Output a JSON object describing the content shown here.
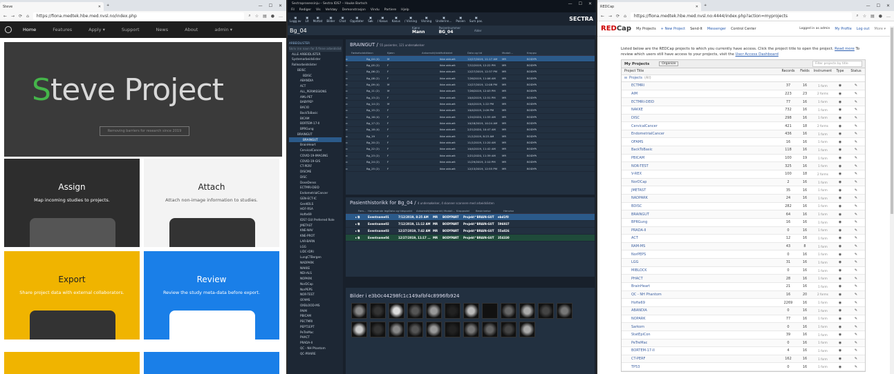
{
  "steve": {
    "tab": "Steve",
    "url": "https://fiona.medtek.hbe.med.nvsl.no/index.php",
    "nav": [
      "Home",
      "Features",
      "Apply ▾",
      "Support",
      "News",
      "About",
      "admin ▾"
    ],
    "hero_title_s": "S",
    "hero_title_rest": "teve Project",
    "hero_subtitle": "Removing barriers for research since 2019",
    "cards": [
      {
        "title": "Assign",
        "desc": "Map incoming studies to projects."
      },
      {
        "title": "Attach",
        "desc": "Attach non-image information to studies."
      },
      {
        "title": "Export",
        "desc": "Share project data with external collaborators."
      },
      {
        "title": "Review",
        "desc": "Review the study meta-data before export."
      }
    ]
  },
  "sectra": {
    "tab": "Sectraprosessinju – Sectra IDS7 – Hauke Bartsch",
    "menu": [
      "Fil",
      "Rediger",
      "Vis",
      "Verktøy",
      "Demonstrasjon",
      "Vindu",
      "Partiere",
      "Hjelp"
    ],
    "toolbar": [
      "Logg av",
      "Lit",
      "Mottat",
      "Bilder",
      "Chat",
      "Oppdater",
      "Søk",
      "/ Kasus",
      "Kasus",
      "/ Visning",
      "Visning",
      "Underinn...",
      "Pasien",
      "Sum pas."
    ],
    "brand": "SECTRA",
    "patient_id": "Bg_04",
    "sex_label": "Kjønn",
    "sex": "Mann",
    "pid_label": "Pasientnummer",
    "pid": "BG_04",
    "age_label": "Alder",
    "tree_head": "ARBEIDLISTER",
    "tree_search": "Skriv inn navn for å finne arbeidslister",
    "tree": [
      "ALLE ARBEIDLISTER",
      "Systemarbeidslister",
      "Rollearbeidslister",
      "BEISC",
      "BDISC",
      "ABANDIA",
      "ACT",
      "ALL_PERMISSIONS",
      "AML-PET",
      "BABYPEP",
      "BACIO",
      "BackToBasic",
      "BICAM",
      "BORTEM-17-II",
      "BPRGung",
      "BRAINGUT",
      "BRAINGUT",
      "BrainHeart",
      "CervicalCancer",
      "COVID-19-IMAGING",
      "COVID-19-GIS",
      "CT-PERF",
      "DISCME",
      "DISC",
      "DoseDenss",
      "ECTMRI-DEID",
      "EndometrialCancer",
      "GEN-ECT-IC",
      "GenKOLS",
      "HOF-RSA",
      "Hofte69",
      "IDS7 GUI Preferred Role",
      "JMETAST",
      "KNE-NAV",
      "KNE-PROT",
      "LAR-BARN",
      "LGG",
      "LIDC-IDRI",
      "LungCTBergen",
      "NADPARK",
      "NAKKE",
      "NDI-ALS",
      "NOPARK",
      "NorDCap",
      "NorPEPS",
      "NOR-TEST",
      "OFAMS",
      "OXBLOOD-MS",
      "PAIM",
      "PBICAM",
      "PECTMRI",
      "PEPT1EPT",
      "PeTreMac",
      "PHACT",
      "PRADA-II",
      "QC - NH Phantom",
      "QC-PRAIRE"
    ],
    "worklist_title": "BRAINGUT",
    "worklist_sub": "55 pasienter, 121 undersøkelser",
    "cols": [
      "Fødselsdato",
      "Navn",
      "Kjønn",
      "Ankomstt(tidspunkt)",
      "Mottbidet",
      "Dato og tid",
      "Modali...",
      "Kroppsdel"
    ],
    "rows": [
      [
        "",
        "Bg_04 (4)",
        "M",
        "",
        "Ikke aktuelt",
        "12/27/2019, 11:17 AM",
        "MR",
        "BODYPART"
      ],
      [
        "",
        "Bg_05 (2)",
        "F",
        "",
        "Ikke aktuelt",
        "7/12/2019, 12:22 PM",
        "MR",
        "BODYPART"
      ],
      [
        "",
        "Bg_06 (2)",
        "F",
        "",
        "Ikke aktuelt",
        "12/27/2019, 12:37 PM",
        "MR",
        "BODYPART"
      ],
      [
        "",
        "Bg_08 (2)",
        "F",
        "",
        "Ikke aktuelt",
        "7/26/2019, 11:06 AM",
        "MR",
        "BODYPART"
      ],
      [
        "",
        "Bg_09 (4)",
        "M",
        "",
        "Ikke aktuelt",
        "12/27/2019, 12:08 PM",
        "MR",
        "BODYPART"
      ],
      [
        "",
        "Bg_11 (2)",
        "M",
        "",
        "Ikke aktuelt",
        "7/26/2019, 12:03 PM",
        "MR",
        "BODYPART"
      ],
      [
        "",
        "Bg_13 (2)",
        "F",
        "",
        "Ikke aktuelt",
        "10/4/2019, 12:51 PM",
        "MR",
        "BODYPART"
      ],
      [
        "",
        "Bg_14 (2)",
        "M",
        "",
        "Ikke aktuelt",
        "10/4/2019, 1:22 PM",
        "MR",
        "BODYPART"
      ],
      [
        "",
        "Bg_15 (2)",
        "F",
        "",
        "Ikke aktuelt",
        "10/4/2019, 2:09 PM",
        "MR",
        "BODYPART"
      ],
      [
        "",
        "Bg_16 (4)",
        "F",
        "",
        "Ikke aktuelt",
        "1/24/2020, 11:55 AM",
        "MR",
        "BODYPART"
      ],
      [
        "",
        "Bg_17 (2)",
        "F",
        "",
        "Ikke aktuelt",
        "10/18/2019, 10:24 AM",
        "MR",
        "BODYPART"
      ],
      [
        "",
        "Bg_18 (4)",
        "F",
        "",
        "Ikke aktuelt",
        "2/21/2020, 10:47 AM",
        "MR",
        "BODYPART"
      ],
      [
        "",
        "Bg_19",
        "F",
        "",
        "Ikke aktuelt",
        "11/1/2019, 8:23 AM",
        "MR",
        "BODYPART"
      ],
      [
        "",
        "Bg_20 (2)",
        "F",
        "",
        "Ikke aktuelt",
        "11/1/2019, 11:20 AM",
        "MR",
        "BODYPART"
      ],
      [
        "",
        "Bg_22 (2)",
        "F",
        "",
        "Ikke aktuelt",
        "10/4/2019, 11:42 AM",
        "MR",
        "BODYPART"
      ],
      [
        "",
        "Bg_23 (2)",
        "F",
        "",
        "Ikke aktuelt",
        "2/21/2020, 11:39 AM",
        "MR",
        "BODYPART"
      ],
      [
        "",
        "Bg_24 (2)",
        "F",
        "",
        "Ikke aktuelt",
        "11/29/2019, 2:10 PM",
        "MR",
        "BODYPART"
      ],
      [
        "",
        "Bg_25 (2)",
        "F",
        "",
        "Ikke aktuelt",
        "12/13/2019, 12:55 PM",
        "MR",
        "BODYPART"
      ]
    ],
    "history_title": "Pasienthistorikk for Bg_04",
    "history_sub": "4 undersøkelser, 4 skanner scannere med arbeidslisten",
    "hcols": [
      "Fem...",
      "Henvisende lege",
      "Dato og tidspunkt",
      "Ankomstt(tidspunkt)",
      "Modali...",
      "Kroppsdel",
      "Beskrivelse",
      "Henvisn"
    ],
    "hrows": [
      [
        "Eventname01",
        "7/12/2019, 8:25 AM",
        "MR",
        "BODYPART",
        "Projekt^BRAIN-GUT",
        "ebd1f0"
      ],
      [
        "Eventname02",
        "7/12/2019, 11:12 AM",
        "MR",
        "BODYPART",
        "Projekt^BRAIN-GUT",
        "596937"
      ],
      [
        "Eventname03",
        "12/27/2019, 7:42 AM",
        "MR",
        "BODYPART",
        "Projekt^BRAIN-GUT",
        "55a826"
      ],
      [
        "Eventname04",
        "12/27/2019, 11:17 ...",
        "MR",
        "BODYPART",
        "Projekt^BRAIN-GUT",
        "354330"
      ]
    ],
    "images_title": "Bilder i e3b0c44298fc1c149afbf4c8996fb924"
  },
  "redcap": {
    "tab": "REDCap",
    "url": "https://fiona.medtek.hbe.med.nvsl.no:4444/index.php?action=myprojects",
    "logo_red": "RED",
    "logo_rest": "Cap",
    "nav": [
      "My Projects",
      "+ New Project",
      "Send-It",
      "Messenger",
      "Control Center"
    ],
    "logged": "Logged in as admin",
    "profile": "My Profile",
    "logout": "Log out",
    "more": "More ▾",
    "intro": "Listed below are the REDCap projects to which you currently have access. Click the project title to open the project. ",
    "intro_link": "Read more",
    "intro2": " To review which users still have access to your projects, visit the ",
    "intro_link2": "User Access Dashboard",
    "table_title": "My Projects",
    "organize": "Organize",
    "filter": "Filter projects by title",
    "cols": [
      "Project Title",
      "Records",
      "Fields",
      "Instrument",
      "Type",
      "Status"
    ],
    "folder": "Projects",
    "folder_count": "(All)",
    "projects": [
      [
        "ECTMRI",
        "37",
        "16",
        "1 form"
      ],
      [
        "AIM",
        "223",
        "23",
        "2 forms"
      ],
      [
        "ECTMRI-DEID",
        "77",
        "16",
        "1 form"
      ],
      [
        "NAKKE",
        "732",
        "16",
        "1 form"
      ],
      [
        "DISC",
        "298",
        "16",
        "1 form"
      ],
      [
        "CervicalCancer",
        "421",
        "18",
        "2 forms"
      ],
      [
        "EndometrialCancer",
        "436",
        "16",
        "1 form"
      ],
      [
        "OFAMS",
        "16",
        "16",
        "1 form"
      ],
      [
        "BackToBasic",
        "118",
        "16",
        "1 form"
      ],
      [
        "PBICAM",
        "100",
        "19",
        "1 form"
      ],
      [
        "NOR-TEST",
        "325",
        "16",
        "1 form"
      ],
      [
        "V-REX",
        "100",
        "18",
        "2 forms"
      ],
      [
        "NorDCap",
        "2",
        "16",
        "1 form"
      ],
      [
        "JMETAST",
        "35",
        "16",
        "1 form"
      ],
      [
        "NADPARK",
        "24",
        "16",
        "1 form"
      ],
      [
        "BDISC",
        "282",
        "16",
        "1 form"
      ],
      [
        "BRAINGUT",
        "64",
        "16",
        "1 form"
      ],
      [
        "BPRGung",
        "16",
        "16",
        "1 form"
      ],
      [
        "PRADA-II",
        "0",
        "16",
        "1 form"
      ],
      [
        "ACT",
        "12",
        "16",
        "1 form"
      ],
      [
        "RAM-MS",
        "43",
        "8",
        "1 form"
      ],
      [
        "NorPEPS",
        "0",
        "16",
        "1 form"
      ],
      [
        "LGG",
        "31",
        "16",
        "1 form"
      ],
      [
        "MIBLOCK",
        "0",
        "16",
        "1 form"
      ],
      [
        "PHACT",
        "28",
        "16",
        "1 form"
      ],
      [
        "BrainHeart",
        "21",
        "16",
        "1 form"
      ],
      [
        "QC - NH Phantom",
        "16",
        "20",
        "2 forms"
      ],
      [
        "Hofte69",
        "2269",
        "16",
        "1 form"
      ],
      [
        "ABANDIA",
        "0",
        "16",
        "1 form"
      ],
      [
        "NOPARK",
        "77",
        "16",
        "1 form"
      ],
      [
        "Sarkom",
        "0",
        "16",
        "1 form"
      ],
      [
        "StatEpiCon",
        "39",
        "16",
        "1 form"
      ],
      [
        "PeTreMac",
        "0",
        "16",
        "1 form"
      ],
      [
        "BORTEM-17-II",
        "4",
        "16",
        "1 form"
      ],
      [
        "CT-PERF",
        "162",
        "16",
        "1 form"
      ],
      [
        "TP53",
        "0",
        "16",
        "1 form"
      ]
    ]
  }
}
